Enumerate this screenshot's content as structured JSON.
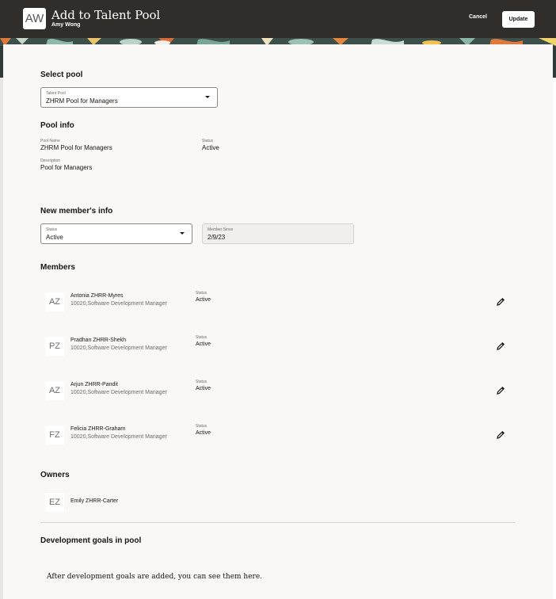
{
  "header": {
    "avatar_initials": "AW",
    "title": "Add to Talent Pool",
    "subtitle": "Amy Wong",
    "cancel_label": "Cancel",
    "update_label": "Update"
  },
  "select_pool": {
    "heading": "Select pool",
    "field_label": "Talent Pool",
    "field_value": "ZHRM Pool for Managers"
  },
  "pool_info": {
    "heading": "Pool info",
    "name_label": "Pool Name",
    "name_value": "ZHRM Pool for Managers",
    "status_label": "Status",
    "status_value": "Active",
    "description_label": "Description",
    "description_value": "Pool for Managers"
  },
  "new_member": {
    "heading": "New member's info",
    "status_label": "Status",
    "status_value": "Active",
    "since_label": "Member Since",
    "since_value": "2/9/23"
  },
  "members": {
    "heading": "Members",
    "items": [
      {
        "initials": "AZ",
        "name": "Antonia ZHRR-Myres",
        "detail": "10020,Software Development Manager",
        "status_label": "Status",
        "status": "Active"
      },
      {
        "initials": "PZ",
        "name": "Pradhan ZHRR-Shekh",
        "detail": "10020,Software Development Manager",
        "status_label": "Status",
        "status": "Active"
      },
      {
        "initials": "AZ",
        "name": "Arjun ZHRR-Pandit",
        "detail": "10020,Software Development Manager",
        "status_label": "Status",
        "status": "Active"
      },
      {
        "initials": "FZ",
        "name": "Felicia ZHRR-Graham",
        "detail": "10020,Software Development Manager",
        "status_label": "Status",
        "status": "Active"
      }
    ]
  },
  "owners": {
    "heading": "Owners",
    "items": [
      {
        "initials": "EZ",
        "name": "Emily ZHRR-Carter"
      }
    ]
  },
  "dev_goals": {
    "heading": "Development goals in pool",
    "empty_message": "After development goals are added, you can see them here."
  },
  "colors": {
    "header_bg": "#312d2a",
    "panel_bg": "#f9f8f6"
  }
}
